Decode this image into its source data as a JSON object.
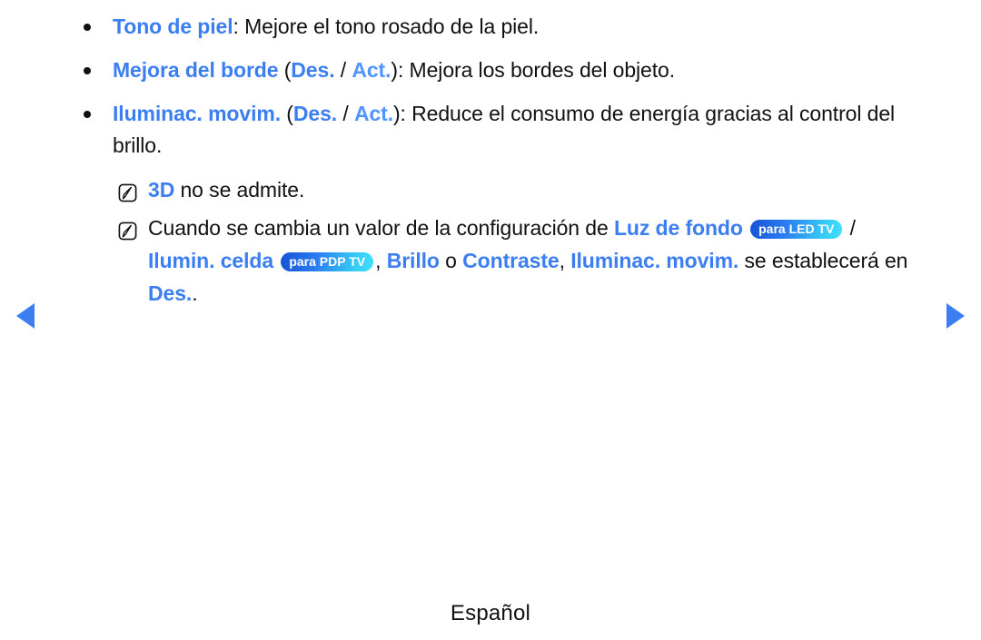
{
  "page": {
    "language_footer": "Español",
    "accent_blue": "#3b7ef2",
    "accent_blue_light": "#4f94ff",
    "badge_gradient_start": "#1652d6",
    "badge_gradient_end": "#41e0ff",
    "text_color": "#111111",
    "background": "#ffffff"
  },
  "nav": {
    "prev_label": "◀",
    "next_label": "▶",
    "prev_name": "previous-page-arrow",
    "next_name": "next-page-arrow"
  },
  "bullets": [
    {
      "icon": "bullet-dot",
      "parts": [
        {
          "text": "Tono de piel",
          "style": "kw"
        },
        {
          "text": ": Mejore el tono rosado de la piel.",
          "style": "plain"
        }
      ]
    },
    {
      "icon": "bullet-dot",
      "parts": [
        {
          "text": "Mejora del borde",
          "style": "kw"
        },
        {
          "text": " (",
          "style": "plain"
        },
        {
          "text": "Des.",
          "style": "kw"
        },
        {
          "text": " / ",
          "style": "plain"
        },
        {
          "text": "Act.",
          "style": "kw-light"
        },
        {
          "text": "): Mejora los bordes del objeto.",
          "style": "plain"
        }
      ]
    },
    {
      "icon": "bullet-dot",
      "parts": [
        {
          "text": "Iluminac. movim.",
          "style": "kw"
        },
        {
          "text": " (",
          "style": "plain"
        },
        {
          "text": "Des.",
          "style": "kw"
        },
        {
          "text": " / ",
          "style": "plain"
        },
        {
          "text": "Act.",
          "style": "kw-light"
        },
        {
          "text": "): Reduce el consumo de energía gracias al control del brillo.",
          "style": "plain"
        }
      ]
    }
  ],
  "notes": [
    {
      "icon": "note-pen-icon",
      "parts": [
        {
          "text": "3D",
          "style": "kw"
        },
        {
          "text": " no se admite.",
          "style": "plain"
        }
      ]
    },
    {
      "icon": "note-pen-icon",
      "parts": [
        {
          "text": "Cuando se cambia un valor de la configuración de ",
          "style": "plain"
        },
        {
          "text": "Luz de fondo",
          "style": "kw"
        },
        {
          "text": " ",
          "style": "plain"
        },
        {
          "text": "para LED TV",
          "style": "badge"
        },
        {
          "text": " / ",
          "style": "plain"
        },
        {
          "text": "Ilumin. celda",
          "style": "kw"
        },
        {
          "text": " ",
          "style": "plain"
        },
        {
          "text": "para PDP TV",
          "style": "badge"
        },
        {
          "text": ", ",
          "style": "plain"
        },
        {
          "text": "Brillo",
          "style": "kw"
        },
        {
          "text": " o ",
          "style": "plain"
        },
        {
          "text": "Contraste",
          "style": "kw"
        },
        {
          "text": ", ",
          "style": "plain"
        },
        {
          "text": "Iluminac. movim.",
          "style": "kw"
        },
        {
          "text": " se establecerá en ",
          "style": "plain"
        },
        {
          "text": "Des.",
          "style": "kw"
        },
        {
          "text": ".",
          "style": "plain"
        }
      ]
    }
  ]
}
